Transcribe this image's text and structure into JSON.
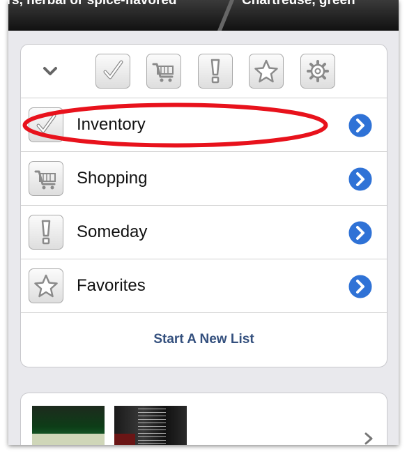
{
  "topbar": {
    "segment_left": "urs, herbal or spice-flavored",
    "segment_right": "Chartreuse, green"
  },
  "toolbar": {
    "collapse_icon": "chevron-down-icon",
    "buttons": [
      "check-icon",
      "cart-icon",
      "exclamation-icon",
      "star-icon",
      "gear-icon"
    ]
  },
  "lists": [
    {
      "label": "Inventory",
      "icon": "check-icon"
    },
    {
      "label": "Shopping",
      "icon": "cart-icon"
    },
    {
      "label": "Someday",
      "icon": "exclamation-icon"
    },
    {
      "label": "Favorites",
      "icon": "star-icon"
    }
  ],
  "new_list": {
    "label": "Start A New List"
  },
  "annotation": {
    "color": "#e8121c"
  },
  "colors": {
    "disclosure_blue": "#2f72d6",
    "link_blue": "#34507e"
  }
}
